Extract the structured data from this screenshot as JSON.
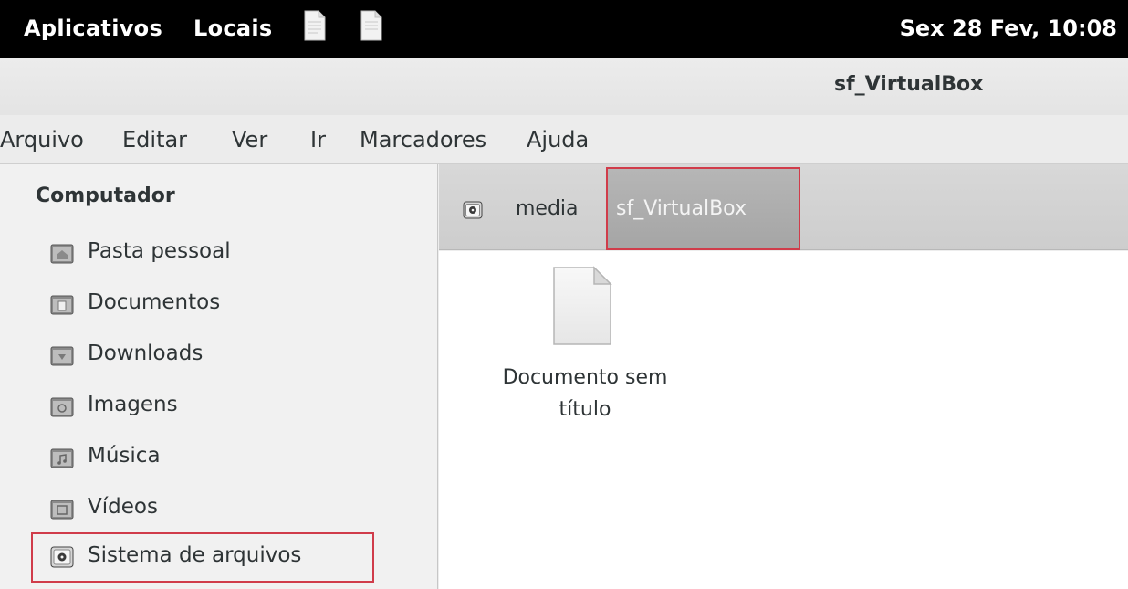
{
  "top_panel": {
    "applications": "Aplicativos",
    "places": "Locais",
    "clock": "Sex 28 Fev, 10:08"
  },
  "window": {
    "title": "sf_VirtualBox"
  },
  "menubar": {
    "items": [
      "Arquivo",
      "Editar",
      "Ver",
      "Ir",
      "Marcadores",
      "Ajuda"
    ]
  },
  "sidebar": {
    "heading": "Computador",
    "places": [
      {
        "label": "Pasta pessoal",
        "icon": "home-folder-icon"
      },
      {
        "label": "Documentos",
        "icon": "documents-folder-icon"
      },
      {
        "label": "Downloads",
        "icon": "downloads-folder-icon"
      },
      {
        "label": "Imagens",
        "icon": "pictures-folder-icon"
      },
      {
        "label": "Música",
        "icon": "music-folder-icon"
      },
      {
        "label": "Vídeos",
        "icon": "videos-folder-icon"
      },
      {
        "label": "Sistema de arquivos",
        "icon": "filesystem-icon"
      }
    ]
  },
  "pathbar": {
    "crumbs": [
      "media",
      "sf_VirtualBox"
    ]
  },
  "files": [
    {
      "name_line1": "Documento sem",
      "name_line2": "título",
      "icon": "text-document-icon"
    }
  ],
  "colors": {
    "highlight_border": "#d03c4a",
    "top_panel_bg": "#000000",
    "active_crumb_bg": "#aaaaaa"
  }
}
